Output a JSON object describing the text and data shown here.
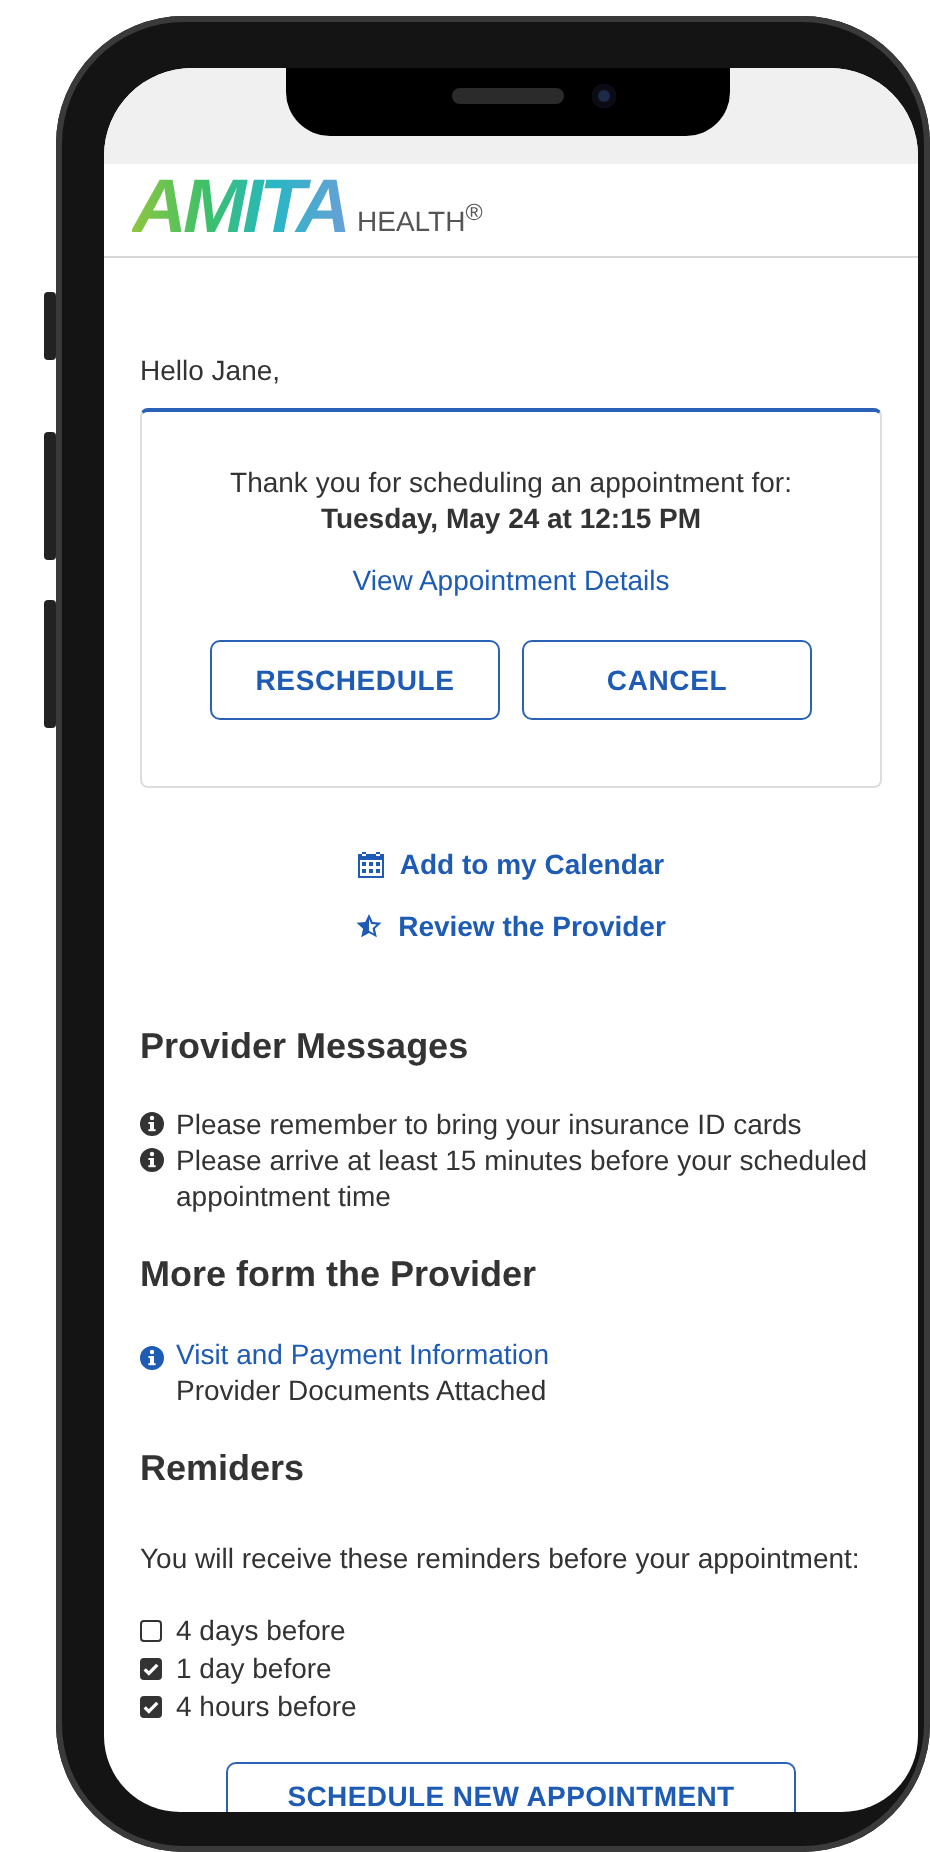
{
  "logo": {
    "wordmark": "AMITA",
    "subtitle": "HEALTH$^{®}$"
  },
  "greeting": "Hello Jane,",
  "confirmation": {
    "intro": "Thank you for scheduling an appointment for:",
    "datetime": "Tuesday, May 24 at 12:15 PM",
    "details_link": "View Appointment Details",
    "buttons": [
      {
        "label": "RESCHEDULE"
      },
      {
        "label": "CANCEL"
      }
    ]
  },
  "actions": [
    {
      "kind": "calendar",
      "label": "Add to my Calendar"
    },
    {
      "kind": "review",
      "label": "Review the Provider"
    }
  ],
  "provider_messages": {
    "title": "Provider Messages",
    "items": [
      "Please remember to bring your insurance ID cards",
      "Please arrive at least 15 minutes before your scheduled appointment time"
    ]
  },
  "more": {
    "title": "More form the Provider",
    "link": "Visit and Payment Information",
    "note": "Provider Documents Attached"
  },
  "reminders": {
    "title": "Remiders",
    "intro": "You will receive these reminders before your appointment:",
    "options": [
      {
        "label": "4 days before",
        "checked": false
      },
      {
        "label": "1 day before",
        "checked": true
      },
      {
        "label": "4 hours before",
        "checked": true
      }
    ]
  },
  "schedule_button": "SCHEDULE NEW APPOINTMENT"
}
